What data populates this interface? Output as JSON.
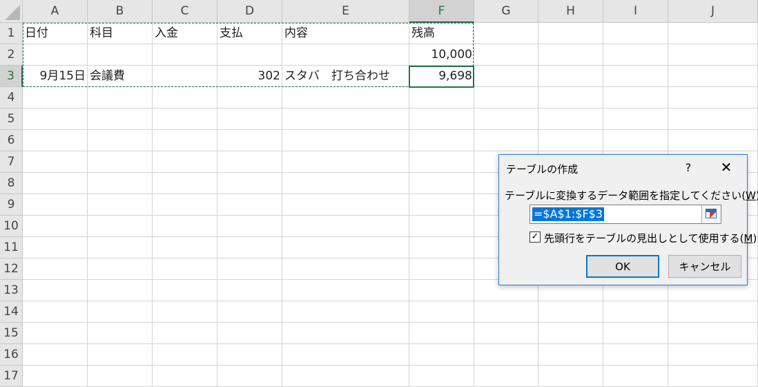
{
  "columns": [
    "A",
    "B",
    "C",
    "D",
    "E",
    "F",
    "G",
    "H",
    "I",
    "J"
  ],
  "selected_column": "F",
  "rows": [
    "1",
    "2",
    "3",
    "4",
    "5",
    "6",
    "7",
    "8",
    "9",
    "10",
    "11",
    "12",
    "13",
    "14",
    "15",
    "16",
    "17"
  ],
  "selected_row": "3",
  "cells": {
    "A1": "日付",
    "B1": "科目",
    "C1": "入金",
    "D1": "支払",
    "E1": "内容",
    "F1": "残高",
    "F2": "10,000",
    "A3": "9月15日",
    "B3": "会議費",
    "D3": "302",
    "E3": "スタバ　打ち合わせ",
    "F3": "9,698"
  },
  "dialog": {
    "title": "テーブルの作成",
    "help": "?",
    "close": "✕",
    "prompt_text": "テーブルに変換するデータ範囲を指定してください(",
    "prompt_key": "W",
    "prompt_end": ")",
    "range_value": "=$A$1:$F$3",
    "range_button_icon": "collapse-dialog-icon",
    "checkbox_checked": true,
    "checkbox_mark": "✓",
    "checkbox_text": "先頭行をテーブルの見出しとして使用する(",
    "checkbox_key": "M",
    "checkbox_end": ")",
    "ok_label": "OK",
    "cancel_label": "キャンセル"
  }
}
